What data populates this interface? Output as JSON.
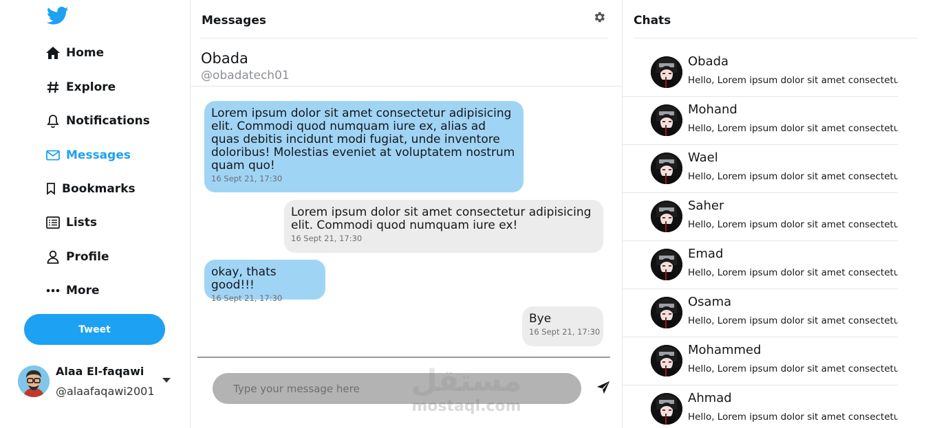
{
  "colors": {
    "accent": "#1da1f2",
    "incoming_bubble": "#a0d4f5",
    "outgoing_bubble": "#ececec",
    "input_bg": "#b3b3b3"
  },
  "sidebar": {
    "logo_icon": "twitter-bird-icon",
    "items": [
      {
        "label": "Home",
        "icon": "home-icon"
      },
      {
        "label": "Explore",
        "icon": "hashtag-icon"
      },
      {
        "label": "Notifications",
        "icon": "bell-icon"
      },
      {
        "label": "Messages",
        "icon": "envelope-icon",
        "active": true
      },
      {
        "label": "Bookmarks",
        "icon": "bookmark-icon"
      },
      {
        "label": "Lists",
        "icon": "list-icon"
      },
      {
        "label": "Profile",
        "icon": "user-icon"
      },
      {
        "label": "More",
        "icon": "more-dots-icon"
      }
    ],
    "tweet_label": "Tweet",
    "user": {
      "name": "Alaa El-faqawi",
      "handle": "@alaafaqawi2001"
    }
  },
  "main": {
    "title": "Messages",
    "contact": {
      "name": "Obada",
      "handle": "@obadatech01"
    },
    "messages": [
      {
        "direction": "in",
        "text": "Lorem ipsum dolor sit amet consectetur adipisicing elit. Commodi quod numquam iure ex, alias ad quas debitis incidunt modi fugiat, unde inventore doloribus! Molestias eveniet at voluptatem nostrum quam quo!",
        "time": "16 Sept 21, 17:30"
      },
      {
        "direction": "out",
        "text": "Lorem ipsum dolor sit amet consectetur adipisicing elit. Commodi quod numquam iure ex!",
        "time": "16 Sept 21, 17:30"
      },
      {
        "direction": "in",
        "text": "okay, thats good!!!",
        "time": "16 Sept 21, 17:30"
      },
      {
        "direction": "out",
        "text": "Bye",
        "time": "16 Sept 21, 17:30"
      }
    ],
    "input_placeholder": "Type your message here",
    "watermark": {
      "arabic": "مستقل",
      "latin": "mostaql.com"
    }
  },
  "chats": {
    "title": "Chats",
    "items": [
      {
        "name": "Obada",
        "snippet": "Hello, Lorem ipsum dolor sit amet consectetur"
      },
      {
        "name": "Mohand",
        "snippet": "Hello, Lorem ipsum dolor sit amet consectetur"
      },
      {
        "name": "Wael",
        "snippet": "Hello, Lorem ipsum dolor sit amet consectetur"
      },
      {
        "name": "Saher",
        "snippet": "Hello, Lorem ipsum dolor sit amet consectetur"
      },
      {
        "name": "Emad",
        "snippet": "Hello, Lorem ipsum dolor sit amet consectetur"
      },
      {
        "name": "Osama",
        "snippet": "Hello, Lorem ipsum dolor sit amet consectetur"
      },
      {
        "name": "Mohammed",
        "snippet": "Hello, Lorem ipsum dolor sit amet consectetur"
      },
      {
        "name": "Ahmad",
        "snippet": "Hello, Lorem ipsum dolor sit amet consectetur"
      }
    ]
  }
}
